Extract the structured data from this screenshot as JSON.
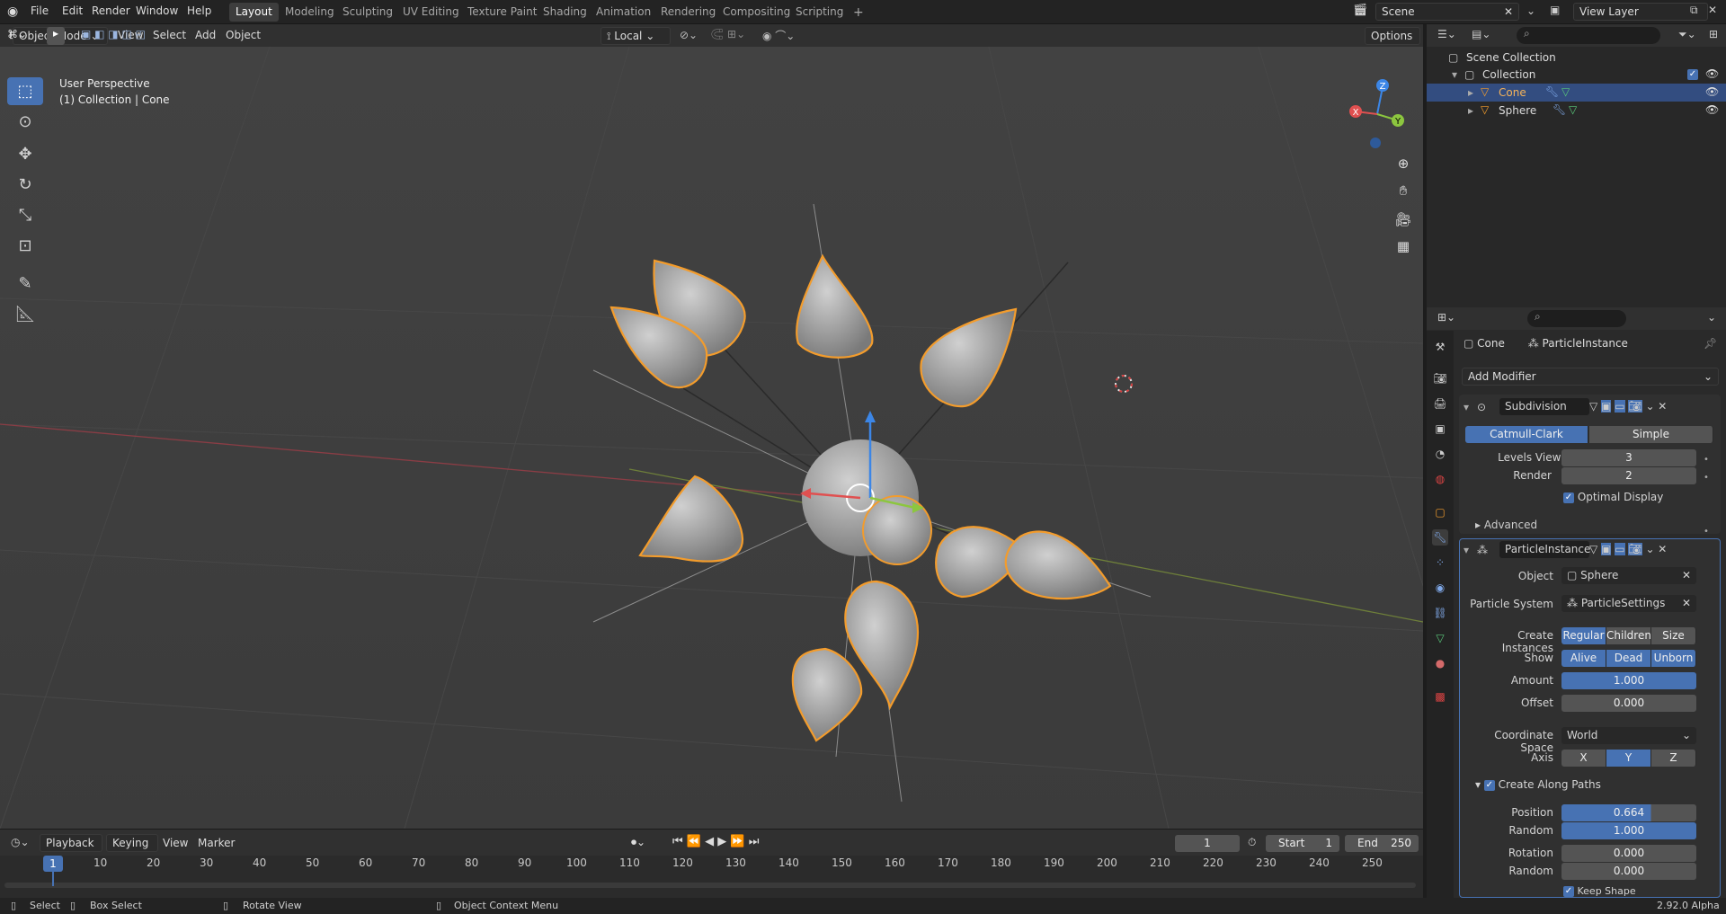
{
  "menus": [
    "File",
    "Edit",
    "Render",
    "Window",
    "Help"
  ],
  "workspaces": [
    "Layout",
    "Modeling",
    "Sculpting",
    "UV Editing",
    "Texture Paint",
    "Shading",
    "Animation",
    "Rendering",
    "Compositing",
    "Scripting"
  ],
  "scene_name": "Scene",
  "view_layer": "View Layer",
  "viewport": {
    "mode": "Object Mode",
    "menus": [
      "View",
      "Select",
      "Add",
      "Object"
    ],
    "transform_orientation": "Local",
    "options_label": "Options",
    "overlay_title": "User Perspective",
    "overlay_subtitle": "(1) Collection | Cone",
    "gizmo": {
      "z": "Z",
      "y": "Y",
      "x": "X"
    }
  },
  "outliner": {
    "root": "Scene Collection",
    "collection": "Collection",
    "objects": [
      "Cone",
      "Sphere"
    ]
  },
  "properties": {
    "object_name": "Cone",
    "modifier_context": "ParticleInstance",
    "add_modifier": "Add Modifier",
    "subdivision": {
      "name": "Subdivision",
      "methods": [
        "Catmull-Clark",
        "Simple"
      ],
      "levels_viewport_label": "Levels Viewport",
      "levels_viewport": "3",
      "render_label": "Render",
      "render": "2",
      "optimal_display": "Optimal Display",
      "advanced": "Advanced"
    },
    "particle_instance": {
      "name": "ParticleInstance",
      "object_label": "Object",
      "object": "Sphere",
      "particle_system_label": "Particle System",
      "particle_system": "ParticleSettings",
      "create_instances_label": "Create Instances",
      "create_instances": [
        "Regular",
        "Children",
        "Size"
      ],
      "show_label": "Show",
      "show": [
        "Alive",
        "Dead",
        "Unborn"
      ],
      "amount_label": "Amount",
      "amount": "1.000",
      "offset_label": "Offset",
      "offset": "0.000",
      "coordinate_space_label": "Coordinate Space",
      "coordinate_space": "World",
      "axis_label": "Axis",
      "axis": [
        "X",
        "Y",
        "Z"
      ],
      "create_along_paths": "Create Along Paths",
      "position_label": "Position",
      "position": "0.664",
      "random_label": "Random",
      "random": "1.000",
      "rotation_label": "Rotation",
      "rotation": "0.000",
      "random2_label": "Random",
      "random2": "0.000",
      "keep_shape": "Keep Shape"
    }
  },
  "timeline": {
    "menus": [
      "Playback",
      "Keying",
      "View",
      "Marker"
    ],
    "current_frame": "1",
    "start_label": "Start",
    "start": "1",
    "end_label": "End",
    "end": "250",
    "ticks": [
      "1",
      "10",
      "20",
      "30",
      "40",
      "50",
      "60",
      "70",
      "80",
      "90",
      "100",
      "110",
      "120",
      "130",
      "140",
      "150",
      "160",
      "170",
      "180",
      "190",
      "200",
      "210",
      "220",
      "230",
      "240",
      "250"
    ]
  },
  "statusbar": {
    "select": "Select",
    "box_select": "Box Select",
    "rotate_view": "Rotate View",
    "context_menu": "Object Context Menu",
    "version": "2.92.0 Alpha"
  },
  "colors": {
    "accent": "#4772b3",
    "selection_outline": "#f39c2c",
    "background": "#3f3f3f"
  }
}
